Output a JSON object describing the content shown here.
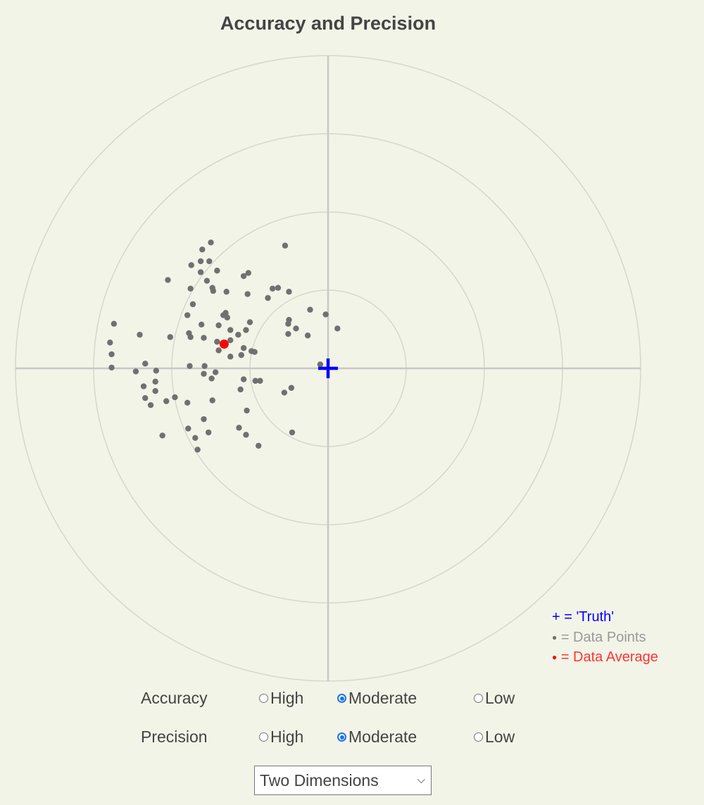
{
  "chart_data": {
    "type": "scatter",
    "title": "Accuracy and Precision",
    "xlabel": "",
    "ylabel": "",
    "xlim": [
      -4,
      4
    ],
    "ylim": [
      -4,
      4
    ],
    "rings": [
      1,
      2,
      3,
      4
    ],
    "grid": false,
    "legend_position": "bottom-right",
    "truth": {
      "x": 0,
      "y": 0
    },
    "average": {
      "x": -1.33,
      "y": 0.31
    },
    "points": [
      {
        "x": -1.5,
        "y": 1.61
      },
      {
        "x": -1.61,
        "y": 1.52
      },
      {
        "x": -0.55,
        "y": 1.57
      },
      {
        "x": -1.63,
        "y": 1.37
      },
      {
        "x": -1.52,
        "y": 1.37
      },
      {
        "x": -1.75,
        "y": 1.32
      },
      {
        "x": -1.42,
        "y": 1.25
      },
      {
        "x": -1.63,
        "y": 1.23
      },
      {
        "x": -1.08,
        "y": 1.18
      },
      {
        "x": -1.02,
        "y": 1.22
      },
      {
        "x": -2.05,
        "y": 1.13
      },
      {
        "x": -1.55,
        "y": 1.12
      },
      {
        "x": -1.76,
        "y": 1.02
      },
      {
        "x": -1.48,
        "y": 1.03
      },
      {
        "x": -1.47,
        "y": 0.99
      },
      {
        "x": -1.3,
        "y": 0.98
      },
      {
        "x": -1.03,
        "y": 0.95
      },
      {
        "x": -0.71,
        "y": 1.02
      },
      {
        "x": -0.64,
        "y": 1.03
      },
      {
        "x": -0.5,
        "y": 0.98
      },
      {
        "x": -0.77,
        "y": 0.9
      },
      {
        "x": -1.73,
        "y": 0.82
      },
      {
        "x": -0.23,
        "y": 0.75
      },
      {
        "x": -0.03,
        "y": 0.69
      },
      {
        "x": -1.31,
        "y": 0.71
      },
      {
        "x": -1.34,
        "y": 0.68
      },
      {
        "x": -1.29,
        "y": 0.65
      },
      {
        "x": -1.0,
        "y": 0.59
      },
      {
        "x": -0.5,
        "y": 0.62
      },
      {
        "x": -0.51,
        "y": 0.57
      },
      {
        "x": -0.41,
        "y": 0.51
      },
      {
        "x": 0.12,
        "y": 0.51
      },
      {
        "x": -0.51,
        "y": 0.44
      },
      {
        "x": -0.26,
        "y": 0.42
      },
      {
        "x": -2.74,
        "y": 0.57
      },
      {
        "x": -1.8,
        "y": 0.68
      },
      {
        "x": -1.62,
        "y": 0.56
      },
      {
        "x": -1.4,
        "y": 0.55
      },
      {
        "x": -1.25,
        "y": 0.49
      },
      {
        "x": -1.05,
        "y": 0.49
      },
      {
        "x": -1.15,
        "y": 0.43
      },
      {
        "x": -1.59,
        "y": 0.39
      },
      {
        "x": -2.41,
        "y": 0.43
      },
      {
        "x": -2.02,
        "y": 0.4
      },
      {
        "x": -1.78,
        "y": 0.45
      },
      {
        "x": -1.76,
        "y": 0.4
      },
      {
        "x": -1.42,
        "y": 0.34
      },
      {
        "x": -1.25,
        "y": 0.36
      },
      {
        "x": -2.79,
        "y": 0.33
      },
      {
        "x": -1.4,
        "y": 0.23
      },
      {
        "x": -1.08,
        "y": 0.26
      },
      {
        "x": -0.98,
        "y": 0.22
      },
      {
        "x": -0.94,
        "y": 0.21
      },
      {
        "x": -1.11,
        "y": 0.17
      },
      {
        "x": -1.25,
        "y": 0.15
      },
      {
        "x": -2.77,
        "y": 0.18
      },
      {
        "x": -0.1,
        "y": 0.05
      },
      {
        "x": -2.34,
        "y": 0.06
      },
      {
        "x": -2.77,
        "y": 0.01
      },
      {
        "x": -2.46,
        "y": -0.04
      },
      {
        "x": -2.2,
        "y": -0.03
      },
      {
        "x": -1.77,
        "y": 0.03
      },
      {
        "x": -1.58,
        "y": 0.03
      },
      {
        "x": -1.44,
        "y": -0.05
      },
      {
        "x": -1.59,
        "y": -0.07
      },
      {
        "x": -1.49,
        "y": -0.13
      },
      {
        "x": -1.08,
        "y": -0.14
      },
      {
        "x": -0.93,
        "y": -0.16
      },
      {
        "x": -0.87,
        "y": -0.16
      },
      {
        "x": -2.21,
        "y": -0.17
      },
      {
        "x": -1.12,
        "y": -0.27
      },
      {
        "x": -0.47,
        "y": -0.25
      },
      {
        "x": -0.56,
        "y": -0.31
      },
      {
        "x": -2.36,
        "y": -0.23
      },
      {
        "x": -2.21,
        "y": -0.29
      },
      {
        "x": -1.96,
        "y": -0.37
      },
      {
        "x": -2.34,
        "y": -0.38
      },
      {
        "x": -2.07,
        "y": -0.42
      },
      {
        "x": -1.8,
        "y": -0.44
      },
      {
        "x": -1.48,
        "y": -0.41
      },
      {
        "x": -2.27,
        "y": -0.47
      },
      {
        "x": -1.04,
        "y": -0.54
      },
      {
        "x": -1.59,
        "y": -0.65
      },
      {
        "x": -1.79,
        "y": -0.77
      },
      {
        "x": -1.53,
        "y": -0.82
      },
      {
        "x": -2.12,
        "y": -0.86
      },
      {
        "x": -1.7,
        "y": -0.89
      },
      {
        "x": -1.67,
        "y": -1.04
      },
      {
        "x": -1.14,
        "y": -0.76
      },
      {
        "x": -1.05,
        "y": -0.85
      },
      {
        "x": -0.46,
        "y": -0.82
      },
      {
        "x": -0.89,
        "y": -0.99
      }
    ],
    "legend": [
      {
        "symbol": "+",
        "label": "= 'Truth'",
        "color": "#0000ff"
      },
      {
        "symbol": "●",
        "label": "= Data Points",
        "color": "#999999"
      },
      {
        "symbol": "●",
        "label": "= Data Average",
        "color": "#ff3333"
      }
    ],
    "colors": {
      "truth": "#0000ff",
      "points": "#707070",
      "average": "#ff0000",
      "rings": "#d6d6ce",
      "axes": "#c8c8c8"
    }
  },
  "controls": {
    "accuracy": {
      "label": "Accuracy",
      "options": [
        "High",
        "Moderate",
        "Low"
      ],
      "selected": "Moderate"
    },
    "precision": {
      "label": "Precision",
      "options": [
        "High",
        "Moderate",
        "Low"
      ],
      "selected": "Moderate"
    },
    "dimension_select": {
      "value": "Two Dimensions"
    }
  }
}
